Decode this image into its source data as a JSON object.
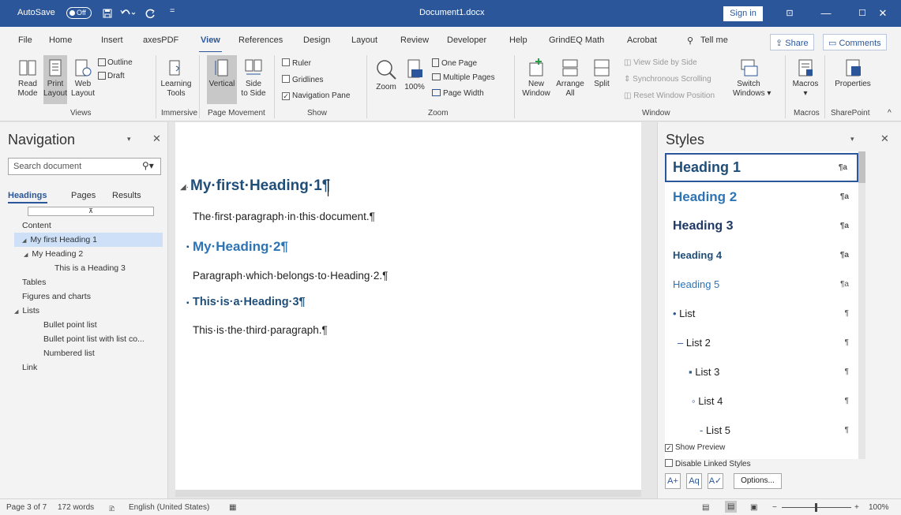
{
  "titlebar": {
    "autosave": "AutoSave",
    "autosave_state": "Off",
    "doc_title": "Document1.docx",
    "sign_in": "Sign in",
    "minimize": "—",
    "maximize": "☐",
    "close": "✕",
    "ribbon_display": "⊡",
    "accent": "#2b579a"
  },
  "menu": {
    "tabs": [
      "File",
      "Home",
      "Insert",
      "axesPDF",
      "View",
      "References",
      "Design",
      "Layout",
      "Review",
      "Developer",
      "Help",
      "GrindEQ Math",
      "Acrobat"
    ],
    "active_tab": "View",
    "tell_me": "Tell me",
    "share": "Share",
    "comments": "Comments"
  },
  "ribbon": {
    "views": {
      "read_mode": [
        "Read",
        "Mode"
      ],
      "print_layout": [
        "Print",
        "Layout"
      ],
      "web_layout": [
        "Web",
        "Layout"
      ],
      "outline": "Outline",
      "draft": "Draft",
      "group": "Views"
    },
    "immersive": {
      "learning_tools": [
        "Learning",
        "Tools"
      ],
      "group": "Immersive"
    },
    "page_movement": {
      "vertical": "Vertical",
      "side_to_side": [
        "Side",
        "to Side"
      ],
      "group": "Page Movement"
    },
    "show": {
      "ruler": "Ruler",
      "gridlines": "Gridlines",
      "navigation_pane": "Navigation Pane",
      "group": "Show"
    },
    "zoom": {
      "zoom": "Zoom",
      "hundred": "100%",
      "one_page": "One Page",
      "multiple_pages": "Multiple Pages",
      "page_width": "Page Width",
      "group": "Zoom"
    },
    "window": {
      "new_window": [
        "New",
        "Window"
      ],
      "arrange_all": [
        "Arrange",
        "All"
      ],
      "split": "Split",
      "view_side_by_side": "View Side by Side",
      "sync_scrolling": "Synchronous Scrolling",
      "reset_window": "Reset Window Position",
      "switch_windows": [
        "Switch",
        "Windows ▾"
      ],
      "group": "Window"
    },
    "macros": {
      "macros": "Macros",
      "group": "Macros"
    },
    "sharepoint": {
      "properties": "Properties",
      "group": "SharePoint"
    }
  },
  "navigation": {
    "title": "Navigation",
    "search_placeholder": "Search document",
    "tabs": [
      "Headings",
      "Pages",
      "Results"
    ],
    "tree": [
      {
        "label": "Content",
        "level": 0
      },
      {
        "label": "My first Heading 1",
        "level": 0,
        "selected": true
      },
      {
        "label": "My Heading 2",
        "level": 1
      },
      {
        "label": "This is a Heading 3",
        "level": 2
      },
      {
        "label": "Tables",
        "level": 0
      },
      {
        "label": "Figures and charts",
        "level": 0
      },
      {
        "label": "Lists",
        "level": 0
      },
      {
        "label": "Bullet point list",
        "level": 1
      },
      {
        "label": "Bullet point list with list co...",
        "level": 1
      },
      {
        "label": "Numbered list",
        "level": 1
      },
      {
        "label": "Link",
        "level": 0
      }
    ]
  },
  "document": {
    "h1": "My·first·Heading·1¶",
    "p1": "The·first·paragraph·in·this·document.¶",
    "h2": "My·Heading·2¶",
    "p2": "Paragraph·which·belongs·to·Heading·2.¶",
    "h3": "This·is·a·Heading·3¶",
    "p3": "This·is·the·third·paragraph.¶"
  },
  "styles": {
    "title": "Styles",
    "items": [
      {
        "label": "Heading 1",
        "mark": "¶a"
      },
      {
        "label": "Heading 2",
        "mark": "¶a"
      },
      {
        "label": "Heading 3",
        "mark": "¶a"
      },
      {
        "label": "Heading 4",
        "mark": "¶a"
      },
      {
        "label": "Heading 5",
        "mark": "¶a"
      },
      {
        "label": "List",
        "mark": "¶"
      },
      {
        "label": "List 2",
        "mark": "¶"
      },
      {
        "label": "List 3",
        "mark": "¶"
      },
      {
        "label": "List 4",
        "mark": "¶"
      },
      {
        "label": "List 5",
        "mark": "¶"
      }
    ],
    "show_preview": "Show Preview",
    "disable_linked": "Disable Linked Styles",
    "options": "Options..."
  },
  "status": {
    "page": "Page 3 of 7",
    "words": "172 words",
    "language": "English (United States)",
    "zoom": "100%"
  }
}
